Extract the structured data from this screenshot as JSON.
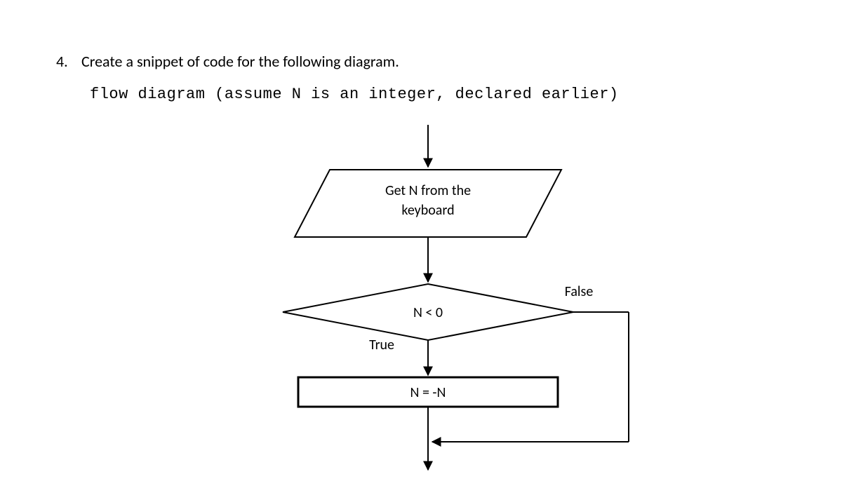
{
  "question": {
    "number": "4.",
    "prompt": "Create a snippet of code for the following diagram."
  },
  "subtitle": "flow diagram (assume N is an integer, declared earlier)",
  "flow": {
    "input_node": {
      "line1": "Get N from the",
      "line2": "keyboard"
    },
    "decision_node": {
      "text": "N < 0"
    },
    "process_node": {
      "text": "N = -N"
    },
    "edge_true": "True",
    "edge_false": "False"
  }
}
